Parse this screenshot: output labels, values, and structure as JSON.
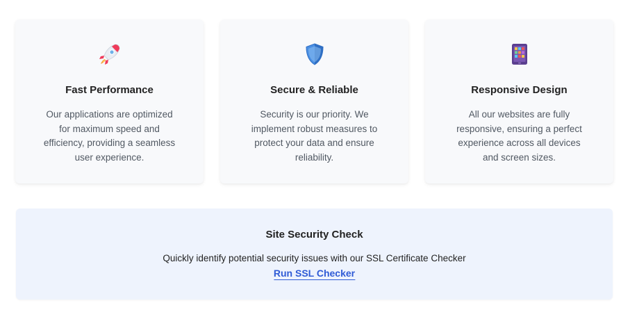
{
  "features": [
    {
      "icon": "rocket-icon",
      "title": "Fast Performance",
      "description": "Our applications are optimized for maximum speed and efficiency, providing a seamless user experience."
    },
    {
      "icon": "shield-icon",
      "title": "Secure & Reliable",
      "description": "Security is our priority. We implement robust measures to protect your data and ensure reliability."
    },
    {
      "icon": "tablet-icon",
      "title": "Responsive Design",
      "description": "All our websites are fully responsive, ensuring a perfect experience across all devices and screen sizes."
    }
  ],
  "security_check": {
    "title": "Site Security Check",
    "description": "Quickly identify potential security issues with our SSL Certificate Checker",
    "link_label": "Run SSL Checker"
  },
  "colors": {
    "card_background": "#f8f9fb",
    "panel_background": "#eef3fd",
    "link": "#2f5bd6"
  }
}
